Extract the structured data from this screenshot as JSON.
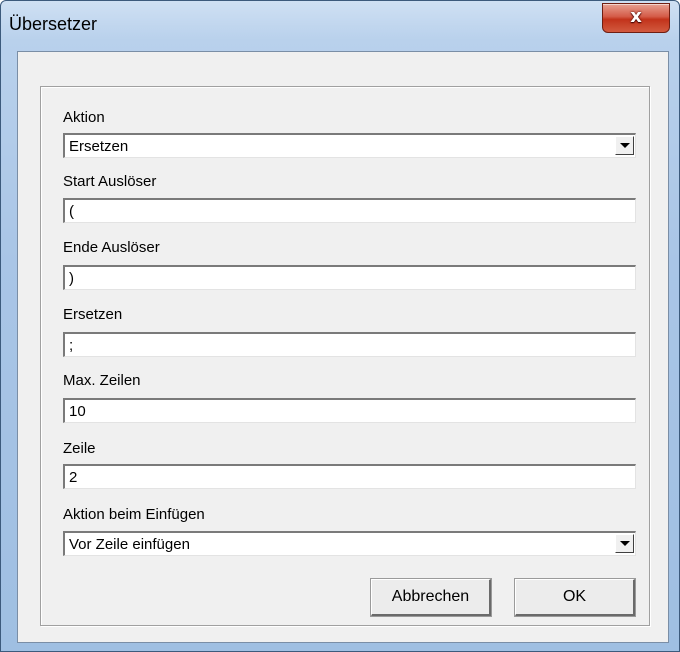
{
  "window": {
    "title": "Übersetzer",
    "close_glyph": "x"
  },
  "form": {
    "aktion": {
      "label": "Aktion",
      "value": "Ersetzen"
    },
    "start": {
      "label": "Start Auslöser",
      "value": "("
    },
    "ende": {
      "label": "Ende Auslöser",
      "value": ")"
    },
    "ersetzen": {
      "label": "Ersetzen",
      "value": ";"
    },
    "max_zeilen": {
      "label": "Max. Zeilen",
      "value": "10"
    },
    "zeile": {
      "label": "Zeile",
      "value": "2"
    },
    "einfuegen": {
      "label": "Aktion beim Einfügen",
      "value": "Vor Zeile einfügen"
    }
  },
  "buttons": {
    "cancel": "Abbrechen",
    "ok": "OK"
  }
}
